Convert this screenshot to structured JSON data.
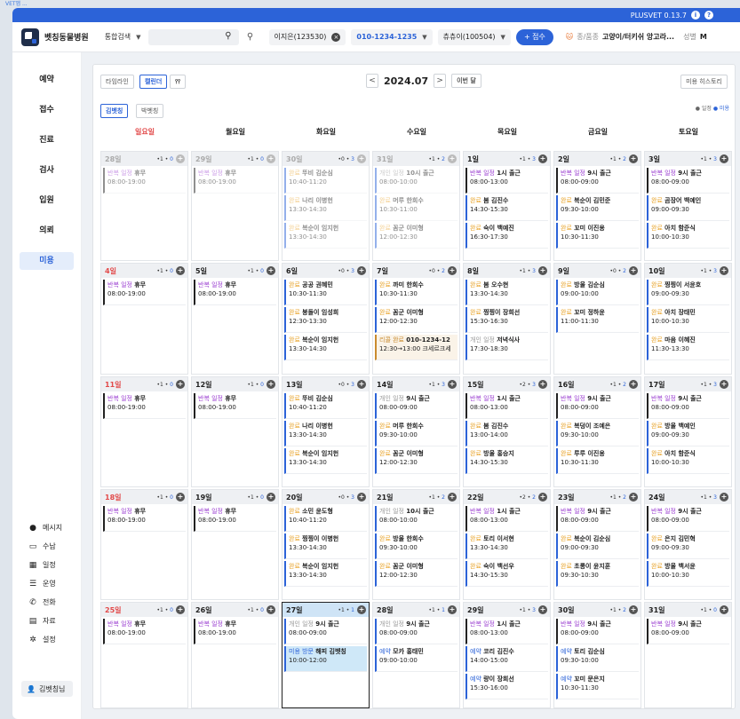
{
  "top_label": "VET앱 ...",
  "version": "PLUSVET 0.13.7",
  "clinic": "벳칭동물병원",
  "search_type": "통합검색",
  "owner": "이지은(123530)",
  "phone": "010-1234-1235",
  "patient": "츄츄이(100504)",
  "register": "+ 접수",
  "species_label": "종/품종",
  "species": "고양이/터키쉬 앙고라...",
  "sex_label": "성별",
  "sex": "M",
  "nav": [
    "예약",
    "접수",
    "진료",
    "검사",
    "입원",
    "의뢰",
    "미용"
  ],
  "side_bottom": [
    {
      "icon": "chat-icon",
      "glyph": "●",
      "label": "메시지"
    },
    {
      "icon": "receipt-icon",
      "glyph": "▭",
      "label": "수납"
    },
    {
      "icon": "calendar-icon",
      "glyph": "▦",
      "label": "일정"
    },
    {
      "icon": "list-icon",
      "glyph": "☰",
      "label": "운영"
    },
    {
      "icon": "phone-icon",
      "glyph": "✆",
      "label": "전화"
    },
    {
      "icon": "document-icon",
      "glyph": "▤",
      "label": "자료"
    },
    {
      "icon": "gear-icon",
      "glyph": "✲",
      "label": "설정"
    }
  ],
  "user": "김벳칭님",
  "toolbar": {
    "timeline": "타임라인",
    "calendar": "캘린더",
    "month": "2024.07",
    "this_month": "이번 달",
    "history": "미용 히스토리",
    "staff1": "김벳칭",
    "staff2": "박벳칭"
  },
  "legend": {
    "a": "● 일정",
    "b": "● 미용"
  },
  "weekdays": [
    "일요일",
    "월요일",
    "화요일",
    "수요일",
    "목요일",
    "금요일",
    "토요일"
  ],
  "colors": {
    "accent": "#2c63d8",
    "sunday": "#e24a4a",
    "repeat": "#9b3fd1",
    "done": "#e8a32a"
  },
  "weeks": [
    [
      {
        "d": "28일",
        "dim": true,
        "c": [
          "1",
          "0"
        ],
        "ev": [
          {
            "k": "rep",
            "t": "반복 일정",
            "n": "휴무",
            "s": "08:00-19:00"
          }
        ]
      },
      {
        "d": "29일",
        "dim": true,
        "c": [
          "1",
          "0"
        ],
        "ev": [
          {
            "k": "rep",
            "t": "반복 일정",
            "n": "휴무",
            "s": "08:00-19:00"
          }
        ]
      },
      {
        "d": "30일",
        "dim": true,
        "c": [
          "0",
          "3"
        ],
        "ev": [
          {
            "k": "done",
            "t": "완료",
            "n": "뚜비 김순심",
            "s": "10:40-11:20"
          },
          {
            "k": "done",
            "t": "완료",
            "n": "나리 이병헌",
            "s": "13:30-14:30"
          },
          {
            "k": "done",
            "t": "완료",
            "n": "복순이 임지헌",
            "s": "13:30-14:30"
          }
        ]
      },
      {
        "d": "31일",
        "dim": true,
        "c": [
          "1",
          "2"
        ],
        "ev": [
          {
            "k": "pers",
            "t": "개인 일정",
            "n": "10시 출근",
            "s": "08:00-10:00"
          },
          {
            "k": "done",
            "t": "완료",
            "n": "머루 한희수",
            "s": "10:30-11:00"
          },
          {
            "k": "done",
            "t": "완료",
            "n": "꼼군 이미형",
            "s": "12:00-12:30"
          }
        ]
      },
      {
        "d": "1일",
        "c": [
          "1",
          "3"
        ],
        "ev": [
          {
            "k": "rep",
            "t": "반복 일정",
            "n": "1시 출근",
            "s": "08:00-13:00"
          },
          {
            "k": "done",
            "t": "완료",
            "n": "봄 김진수",
            "s": "14:30-15:30"
          },
          {
            "k": "done",
            "t": "완료",
            "n": "숙이 백예진",
            "s": "16:30-17:30"
          }
        ]
      },
      {
        "d": "2일",
        "c": [
          "1",
          "2"
        ],
        "ev": [
          {
            "k": "rep",
            "t": "반복 일정",
            "n": "9시 출근",
            "s": "08:00-09:00"
          },
          {
            "k": "done",
            "t": "완료",
            "n": "복순이 김민준",
            "s": "09:30-10:00"
          },
          {
            "k": "done",
            "t": "완료",
            "n": "꼬미 이진용",
            "s": "10:30-11:30"
          }
        ]
      },
      {
        "d": "3일",
        "c": [
          "1",
          "3"
        ],
        "ev": [
          {
            "k": "rep",
            "t": "반복 일정",
            "n": "9시 출근",
            "s": "08:00-09:00"
          },
          {
            "k": "done",
            "t": "완료",
            "n": "곰장어 백예인",
            "s": "09:00-09:30"
          },
          {
            "k": "done",
            "t": "완료",
            "n": "아치 함준식",
            "s": "10:00-10:30"
          }
        ]
      }
    ],
    [
      {
        "d": "4일",
        "sun": true,
        "c": [
          "1",
          "0"
        ],
        "ev": [
          {
            "k": "rep",
            "t": "반복 일정",
            "n": "휴무",
            "s": "08:00-19:00"
          }
        ]
      },
      {
        "d": "5일",
        "c": [
          "1",
          "0"
        ],
        "ev": [
          {
            "k": "rep",
            "t": "반복 일정",
            "n": "휴무",
            "s": "08:00-19:00"
          }
        ]
      },
      {
        "d": "6일",
        "c": [
          "0",
          "3"
        ],
        "ev": [
          {
            "k": "done",
            "t": "완료",
            "n": "공공 권혜민",
            "s": "10:30-11:30"
          },
          {
            "k": "done",
            "t": "완료",
            "n": "봉돌이 임성희",
            "s": "12:30-13:30"
          },
          {
            "k": "done",
            "t": "완료",
            "n": "복순이 임지헌",
            "s": "13:30-14:30"
          }
        ]
      },
      {
        "d": "7일",
        "c": [
          "0",
          "2"
        ],
        "ev": [
          {
            "k": "done",
            "t": "완료",
            "n": "까미 한희수",
            "s": "10:30-11:30"
          },
          {
            "k": "done",
            "t": "완료",
            "n": "꼼군 이미형",
            "s": "12:00-12:30"
          },
          {
            "k": "rel",
            "t": "리콜 완료",
            "n": "010-1234-12",
            "s": "12:30→13:00 크세르크세"
          }
        ]
      },
      {
        "d": "8일",
        "c": [
          "1",
          "3"
        ],
        "ev": [
          {
            "k": "done",
            "t": "완료",
            "n": "봄 오수현",
            "s": "13:30-14:30"
          },
          {
            "k": "done",
            "t": "완료",
            "n": "찡찡이 장희선",
            "s": "15:30-16:30"
          },
          {
            "k": "pers",
            "t": "개인 일정",
            "n": "저녁식사",
            "s": "17:30-18:30"
          }
        ]
      },
      {
        "d": "9일",
        "c": [
          "0",
          "2"
        ],
        "ev": [
          {
            "k": "done",
            "t": "완료",
            "n": "방울 김순심",
            "s": "09:00-10:00"
          },
          {
            "k": "done",
            "t": "완료",
            "n": "꼬미 정하윤",
            "s": "11:00-11:30"
          }
        ]
      },
      {
        "d": "10일",
        "c": [
          "1",
          "3"
        ],
        "ev": [
          {
            "k": "done",
            "t": "완료",
            "n": "찡찡이 서윤호",
            "s": "09:00-09:30"
          },
          {
            "k": "done",
            "t": "완료",
            "n": "아치 장태민",
            "s": "10:00-10:30"
          },
          {
            "k": "done",
            "t": "완료",
            "n": "마음 이혜진",
            "s": "11:30-13:30"
          }
        ]
      }
    ],
    [
      {
        "d": "11일",
        "sun": true,
        "c": [
          "1",
          "0"
        ],
        "ev": [
          {
            "k": "rep",
            "t": "반복 일정",
            "n": "휴무",
            "s": "08:00-19:00"
          }
        ]
      },
      {
        "d": "12일",
        "c": [
          "1",
          "0"
        ],
        "ev": [
          {
            "k": "rep",
            "t": "반복 일정",
            "n": "휴무",
            "s": "08:00-19:00"
          }
        ]
      },
      {
        "d": "13일",
        "c": [
          "0",
          "3"
        ],
        "ev": [
          {
            "k": "done",
            "t": "완료",
            "n": "뚜비 김순심",
            "s": "10:40-11:20"
          },
          {
            "k": "done",
            "t": "완료",
            "n": "나리 이병헌",
            "s": "13:30-14:30"
          },
          {
            "k": "done",
            "t": "완료",
            "n": "복순이 임지헌",
            "s": "13:30-14:30"
          }
        ]
      },
      {
        "d": "14일",
        "c": [
          "1",
          "3"
        ],
        "ev": [
          {
            "k": "pers",
            "t": "개인 일정",
            "n": "9시 출근",
            "s": "08:00-09:00"
          },
          {
            "k": "done",
            "t": "완료",
            "n": "머루 한희수",
            "s": "09:30-10:00"
          },
          {
            "k": "done",
            "t": "완료",
            "n": "꼼군 이미형",
            "s": "12:00-12:30"
          }
        ]
      },
      {
        "d": "15일",
        "c": [
          "2",
          "3"
        ],
        "ev": [
          {
            "k": "rep",
            "t": "반복 일정",
            "n": "1시 출근",
            "s": "08:00-13:00"
          },
          {
            "k": "done",
            "t": "완료",
            "n": "봄 김진수",
            "s": "13:00-14:00"
          },
          {
            "k": "done",
            "t": "완료",
            "n": "방울 홍승지",
            "s": "14:30-15:30"
          }
        ]
      },
      {
        "d": "16일",
        "c": [
          "1",
          "2"
        ],
        "ev": [
          {
            "k": "rep",
            "t": "반복 일정",
            "n": "9시 출근",
            "s": "08:00-09:00"
          },
          {
            "k": "done",
            "t": "완료",
            "n": "복덩이 조예은",
            "s": "09:30-10:00"
          },
          {
            "k": "done",
            "t": "완료",
            "n": "루루 이진용",
            "s": "10:30-11:30"
          }
        ]
      },
      {
        "d": "17일",
        "c": [
          "1",
          "3"
        ],
        "ev": [
          {
            "k": "rep",
            "t": "반복 일정",
            "n": "9시 출근",
            "s": "08:00-09:00"
          },
          {
            "k": "done",
            "t": "완료",
            "n": "방울 백예인",
            "s": "09:00-09:30"
          },
          {
            "k": "done",
            "t": "완료",
            "n": "아치 함준식",
            "s": "10:00-10:30"
          }
        ]
      }
    ],
    [
      {
        "d": "18일",
        "sun": true,
        "c": [
          "1",
          "0"
        ],
        "ev": [
          {
            "k": "rep",
            "t": "반복 일정",
            "n": "휴무",
            "s": "08:00-19:00"
          }
        ]
      },
      {
        "d": "19일",
        "c": [
          "1",
          "0"
        ],
        "ev": [
          {
            "k": "rep",
            "t": "반복 일정",
            "n": "휴무",
            "s": "08:00-19:00"
          }
        ]
      },
      {
        "d": "20일",
        "c": [
          "0",
          "3"
        ],
        "ev": [
          {
            "k": "done",
            "t": "완료",
            "n": "소민 윤도형",
            "s": "10:40-11:20"
          },
          {
            "k": "done",
            "t": "완료",
            "n": "찡찡이 이병헌",
            "s": "13:30-14:30"
          },
          {
            "k": "done",
            "t": "완료",
            "n": "복순이 임지헌",
            "s": "13:30-14:30"
          }
        ]
      },
      {
        "d": "21일",
        "c": [
          "1",
          "2"
        ],
        "ev": [
          {
            "k": "pers",
            "t": "개인 일정",
            "n": "10시 출근",
            "s": "08:00-10:00"
          },
          {
            "k": "done",
            "t": "완료",
            "n": "방울 한희수",
            "s": "09:30-10:00"
          },
          {
            "k": "done",
            "t": "완료",
            "n": "꼼군 이미형",
            "s": "12:00-12:30"
          }
        ]
      },
      {
        "d": "22일",
        "c": [
          "2",
          "2"
        ],
        "ev": [
          {
            "k": "rep",
            "t": "반복 일정",
            "n": "1시 출근",
            "s": "08:00-13:00"
          },
          {
            "k": "done",
            "t": "완료",
            "n": "토리 이서현",
            "s": "13:30-14:30"
          },
          {
            "k": "done",
            "t": "완료",
            "n": "숙이 백선우",
            "s": "14:30-15:30"
          }
        ]
      },
      {
        "d": "23일",
        "c": [
          "1",
          "2"
        ],
        "ev": [
          {
            "k": "rep",
            "t": "반복 일정",
            "n": "9시 출근",
            "s": "08:00-09:00"
          },
          {
            "k": "done",
            "t": "완료",
            "n": "복순이 김순심",
            "s": "09:00-09:30"
          },
          {
            "k": "done",
            "t": "완료",
            "n": "초롱이 윤지훈",
            "s": "09:30-10:30"
          }
        ]
      },
      {
        "d": "24일",
        "c": [
          "1",
          "3"
        ],
        "ev": [
          {
            "k": "rep",
            "t": "반복 일정",
            "n": "9시 출근",
            "s": "08:00-09:00"
          },
          {
            "k": "done",
            "t": "완료",
            "n": "은지 김민혁",
            "s": "09:00-09:30"
          },
          {
            "k": "done",
            "t": "완료",
            "n": "방울 백서윤",
            "s": "10:00-10:30"
          }
        ]
      }
    ],
    [
      {
        "d": "25일",
        "sun": true,
        "c": [
          "1",
          "0"
        ],
        "ev": [
          {
            "k": "rep",
            "t": "반복 일정",
            "n": "휴무",
            "s": "08:00-19:00"
          }
        ]
      },
      {
        "d": "26일",
        "c": [
          "1",
          "0"
        ],
        "ev": [
          {
            "k": "rep",
            "t": "반복 일정",
            "n": "휴무",
            "s": "08:00-19:00"
          }
        ]
      },
      {
        "d": "27일",
        "today": true,
        "c": [
          "1",
          "1"
        ],
        "ev": [
          {
            "k": "pers",
            "t": "개인 일정",
            "n": "9시 출근",
            "s": "08:00-09:00"
          },
          {
            "k": "hl",
            "t": "미용 방문",
            "n": "해피 김벳칭",
            "s": "10:00-12:00"
          }
        ]
      },
      {
        "d": "28일",
        "c": [
          "1",
          "1"
        ],
        "ev": [
          {
            "k": "pers",
            "t": "개인 일정",
            "n": "9시 출근",
            "s": "08:00-09:00"
          },
          {
            "k": "res",
            "t": "예약",
            "n": "모카 홍태민",
            "s": "09:00-10:00"
          }
        ]
      },
      {
        "d": "29일",
        "c": [
          "1",
          "3"
        ],
        "ev": [
          {
            "k": "rep",
            "t": "반복 일정",
            "n": "1시 출근",
            "s": "08:00-13:00"
          },
          {
            "k": "res",
            "t": "예약",
            "n": "코리 김진수",
            "s": "14:00-15:00"
          },
          {
            "k": "res",
            "t": "예약",
            "n": "량이 장희선",
            "s": "15:30-16:00"
          }
        ]
      },
      {
        "d": "30일",
        "c": [
          "1",
          "2"
        ],
        "ev": [
          {
            "k": "rep",
            "t": "반복 일정",
            "n": "9시 출근",
            "s": "08:00-09:00"
          },
          {
            "k": "res",
            "t": "예약",
            "n": "토리 김순심",
            "s": "09:30-10:00"
          },
          {
            "k": "res",
            "t": "예약",
            "n": "꼬미 문은지",
            "s": "10:30-11:30"
          }
        ]
      },
      {
        "d": "31일",
        "c": [
          "1",
          "0"
        ],
        "ev": [
          {
            "k": "rep",
            "t": "반복 일정",
            "n": "9시 출근",
            "s": "08:00-09:00"
          }
        ]
      }
    ]
  ]
}
